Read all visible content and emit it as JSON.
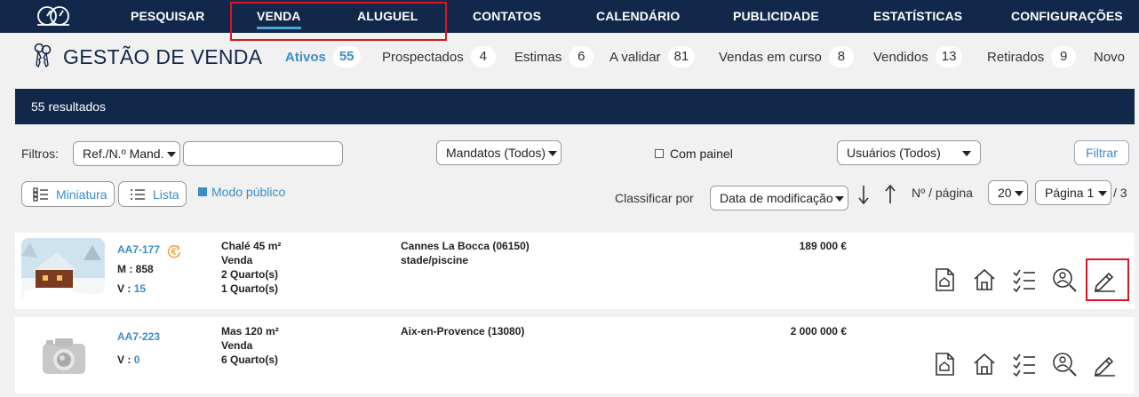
{
  "nav": {
    "items": [
      "PESQUISAR",
      "VENDA",
      "ALUGUEL",
      "CONTATOS",
      "CALENDÁRIO",
      "PUBLICIDADE",
      "ESTATÍSTICAS",
      "CONFIGURAÇÕES"
    ],
    "active": "VENDA"
  },
  "header": {
    "title": "GESTÃO DE VENDA"
  },
  "status_tabs": [
    {
      "label": "Ativos",
      "count": "55",
      "active": true
    },
    {
      "label": "Prospectados",
      "count": "4"
    },
    {
      "label": "Estimas",
      "count": "6"
    },
    {
      "label": "A validar",
      "count": "81"
    },
    {
      "label": "Vendas em curso",
      "count": "8"
    },
    {
      "label": "Vendidos",
      "count": "13"
    },
    {
      "label": "Retirados",
      "count": "9"
    },
    {
      "label": "Novo"
    }
  ],
  "results": {
    "text": "55 resultados"
  },
  "filters": {
    "label": "Filtros:",
    "ref_select": "Ref./N.º Mand.",
    "ref_input_value": "",
    "mandates_select": "Mandatos (Todos)",
    "panel_checkbox": "Com painel",
    "users_select": "Usuários (Todos)",
    "filter_button": "Filtrar"
  },
  "view": {
    "thumbnail_button": "Miniatura",
    "list_button": "Lista",
    "public_mode": "Modo público"
  },
  "sort": {
    "label": "Classificar por",
    "select": "Data de modificação",
    "per_page_label": "Nº / página",
    "per_page": "20",
    "page_select": "Página 1",
    "page_total": "/ 3"
  },
  "listings": [
    {
      "ref": "AA7-177",
      "m_label": "M :",
      "m_value": "858",
      "v_label": "V :",
      "v_value": "15",
      "type_line": "Chalé 45 m²",
      "transaction": "Venda",
      "rooms": [
        "2 Quarto(s)",
        "1 Quarto(s)"
      ],
      "location": "Cannes La Bocca (06150)",
      "location_note": "stade/piscine",
      "price": "189 000 €"
    },
    {
      "ref": "AA7-223",
      "v_label": "V :",
      "v_value": "0",
      "type_line": "Mas 120 m²",
      "transaction": "Venda",
      "rooms": [
        "6 Quarto(s)"
      ],
      "location": "Aix-en-Provence (13080)",
      "price": "2 000 000 €"
    }
  ],
  "colors": {
    "nav_bg": "#12284b",
    "accent": "#3a8dc5",
    "highlight": "#e0141e"
  }
}
